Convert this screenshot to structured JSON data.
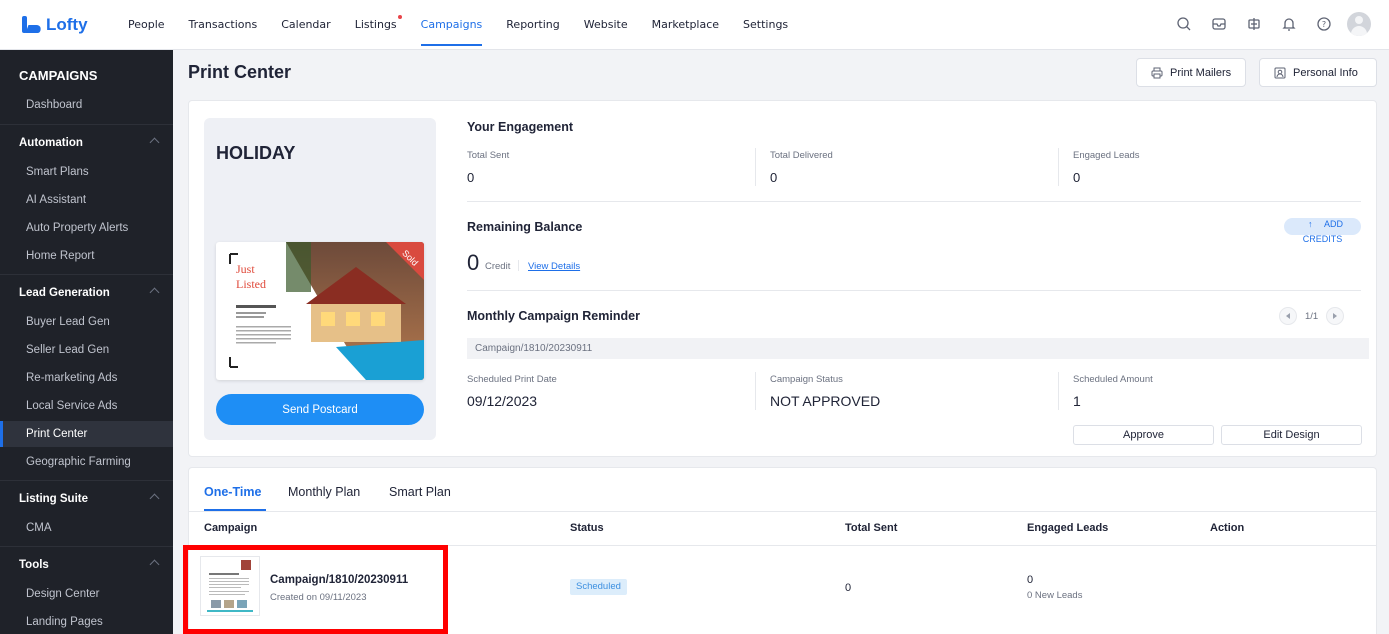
{
  "brand": {
    "name": "Lofty",
    "accent": "#1e6fe8"
  },
  "topnav": {
    "items": [
      {
        "label": "People"
      },
      {
        "label": "Transactions"
      },
      {
        "label": "Calendar"
      },
      {
        "label": "Listings"
      },
      {
        "label": "Campaigns"
      },
      {
        "label": "Reporting"
      },
      {
        "label": "Website"
      },
      {
        "label": "Marketplace"
      },
      {
        "label": "Settings"
      }
    ],
    "active": "Campaigns",
    "icons": [
      "search-icon",
      "inbox-icon",
      "phone-icon",
      "bell-icon",
      "help-icon",
      "avatar"
    ]
  },
  "sidebar": {
    "title": "CAMPAIGNS",
    "dashboard": "Dashboard",
    "automation": "Automation",
    "smart_plans": "Smart Plans",
    "ai_assistant": "AI Assistant",
    "auto_property_alerts": "Auto Property Alerts",
    "home_report": "Home Report",
    "lead_generation": "Lead Generation",
    "buyer_lead_gen": "Buyer Lead Gen",
    "seller_lead_gen": "Seller Lead Gen",
    "remarketing_ads": "Re-marketing Ads",
    "local_service_ads": "Local Service Ads",
    "print_center": "Print Center",
    "geographic_farming": "Geographic Farming",
    "listing_suite": "Listing Suite",
    "cma": "CMA",
    "tools": "Tools",
    "design_center": "Design Center",
    "landing_pages": "Landing Pages"
  },
  "page": {
    "title": "Print Center",
    "print_mailers": "Print Mailers",
    "personal_info": "Personal Info"
  },
  "preview": {
    "title": "HOLIDAY",
    "postcard_just": "Just",
    "postcard_listed": "Listed",
    "postcard_sold": "Sold",
    "send_button": "Send Postcard"
  },
  "engagement": {
    "title": "Your Engagement",
    "total_sent_label": "Total Sent",
    "total_sent": "0",
    "total_delivered_label": "Total Delivered",
    "total_delivered": "0",
    "engaged_leads_label": "Engaged Leads",
    "engaged_leads": "0"
  },
  "balance": {
    "title": "Remaining Balance",
    "amount": "0",
    "unit": "Credit",
    "view_details": "View Details",
    "add_credits_1": "ADD",
    "add_credits_2": "CREDITS"
  },
  "reminder": {
    "title": "Monthly Campaign Reminder",
    "pager": "1/1",
    "campaign": "Campaign/1810/20230911",
    "print_date_label": "Scheduled Print Date",
    "print_date": "09/12/2023",
    "status_label": "Campaign Status",
    "status": "NOT APPROVED",
    "amount_label": "Scheduled Amount",
    "amount": "1",
    "approve": "Approve",
    "edit_design": "Edit Design"
  },
  "tabs": [
    {
      "label": "One-Time"
    },
    {
      "label": "Monthly Plan"
    },
    {
      "label": "Smart Plan"
    }
  ],
  "table": {
    "columns": [
      "Campaign",
      "Status",
      "Total Sent",
      "Engaged Leads",
      "Action"
    ],
    "rows": [
      {
        "name": "Campaign/1810/20230911",
        "created": "Created on 09/11/2023",
        "status": "Scheduled",
        "total_sent": "0",
        "engaged_leads": "0",
        "new_leads": "0 New Leads"
      }
    ]
  }
}
